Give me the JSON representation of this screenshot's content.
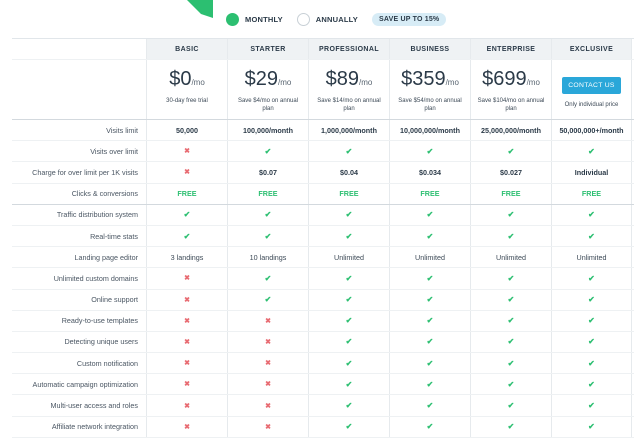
{
  "colors": {
    "accent": "#2cbf71",
    "cross": "#e86b72",
    "button": "#2aa7d9",
    "header_bg": "#eff2f4"
  },
  "billing": {
    "monthly_label": "MONTHLY",
    "annually_label": "ANNUALLY",
    "selected": "MONTHLY",
    "save_badge": "SAVE UP TO 15%"
  },
  "plans": [
    {
      "name": "BASIC",
      "price": "$0",
      "per": "/mo",
      "note": "30-day free trial"
    },
    {
      "name": "STARTER",
      "price": "$29",
      "per": "/mo",
      "note": "Save $4/mo on annual plan"
    },
    {
      "name": "PROFESSIONAL",
      "price": "$89",
      "per": "/mo",
      "note": "Save $14/mo on annual plan"
    },
    {
      "name": "BUSINESS",
      "price": "$359",
      "per": "/mo",
      "note": "Save $54/mo on annual plan"
    },
    {
      "name": "ENTERPRISE",
      "price": "$699",
      "per": "/mo",
      "note": "Save $104/mo on annual plan"
    },
    {
      "name": "EXCLUSIVE",
      "button": "CONTACT US",
      "note": "Only individual price"
    }
  ],
  "rows": [
    {
      "label": "Visits limit",
      "cells": [
        {
          "t": "text",
          "v": "50,000",
          "b": true
        },
        {
          "t": "text",
          "v": "100,000/month",
          "b": true
        },
        {
          "t": "text",
          "v": "1,000,000/month",
          "b": true
        },
        {
          "t": "text",
          "v": "10,000,000/month",
          "b": true
        },
        {
          "t": "text",
          "v": "25,000,000/month",
          "b": true
        },
        {
          "t": "text",
          "v": "50,000,000+/month",
          "b": true
        }
      ]
    },
    {
      "label": "Visits over limit",
      "cells": [
        {
          "t": "cross"
        },
        {
          "t": "check"
        },
        {
          "t": "check"
        },
        {
          "t": "check"
        },
        {
          "t": "check"
        },
        {
          "t": "check"
        }
      ]
    },
    {
      "label": "Charge for over limit per 1K visits",
      "cells": [
        {
          "t": "cross"
        },
        {
          "t": "text",
          "v": "$0.07",
          "b": true
        },
        {
          "t": "text",
          "v": "$0.04",
          "b": true
        },
        {
          "t": "text",
          "v": "$0.034",
          "b": true
        },
        {
          "t": "text",
          "v": "$0.027",
          "b": true
        },
        {
          "t": "text",
          "v": "Individual",
          "b": true
        }
      ]
    },
    {
      "label": "Clicks & conversions",
      "group_end": true,
      "cells": [
        {
          "t": "free",
          "v": "FREE"
        },
        {
          "t": "free",
          "v": "FREE"
        },
        {
          "t": "free",
          "v": "FREE"
        },
        {
          "t": "free",
          "v": "FREE"
        },
        {
          "t": "free",
          "v": "FREE"
        },
        {
          "t": "free",
          "v": "FREE"
        }
      ]
    },
    {
      "label": "Traffic distribution system",
      "cells": [
        {
          "t": "check"
        },
        {
          "t": "check"
        },
        {
          "t": "check"
        },
        {
          "t": "check"
        },
        {
          "t": "check"
        },
        {
          "t": "check"
        }
      ]
    },
    {
      "label": "Real-time stats",
      "cells": [
        {
          "t": "check"
        },
        {
          "t": "check"
        },
        {
          "t": "check"
        },
        {
          "t": "check"
        },
        {
          "t": "check"
        },
        {
          "t": "check"
        }
      ]
    },
    {
      "label": "Landing page editor",
      "cells": [
        {
          "t": "text",
          "v": "3 landings"
        },
        {
          "t": "text",
          "v": "10 landings"
        },
        {
          "t": "text",
          "v": "Unlimited"
        },
        {
          "t": "text",
          "v": "Unlimited"
        },
        {
          "t": "text",
          "v": "Unlimited"
        },
        {
          "t": "text",
          "v": "Unlimited"
        }
      ]
    },
    {
      "label": "Unlimited custom domains",
      "cells": [
        {
          "t": "cross"
        },
        {
          "t": "check"
        },
        {
          "t": "check"
        },
        {
          "t": "check"
        },
        {
          "t": "check"
        },
        {
          "t": "check"
        }
      ]
    },
    {
      "label": "Online support",
      "cells": [
        {
          "t": "cross"
        },
        {
          "t": "check"
        },
        {
          "t": "check"
        },
        {
          "t": "check"
        },
        {
          "t": "check"
        },
        {
          "t": "check"
        }
      ]
    },
    {
      "label": "Ready-to-use templates",
      "cells": [
        {
          "t": "cross"
        },
        {
          "t": "cross"
        },
        {
          "t": "check"
        },
        {
          "t": "check"
        },
        {
          "t": "check"
        },
        {
          "t": "check"
        }
      ]
    },
    {
      "label": "Detecting unique users",
      "cells": [
        {
          "t": "cross"
        },
        {
          "t": "cross"
        },
        {
          "t": "check"
        },
        {
          "t": "check"
        },
        {
          "t": "check"
        },
        {
          "t": "check"
        }
      ]
    },
    {
      "label": "Custom notification",
      "cells": [
        {
          "t": "cross"
        },
        {
          "t": "cross"
        },
        {
          "t": "check"
        },
        {
          "t": "check"
        },
        {
          "t": "check"
        },
        {
          "t": "check"
        }
      ]
    },
    {
      "label": "Automatic campaign optimization",
      "cells": [
        {
          "t": "cross"
        },
        {
          "t": "cross"
        },
        {
          "t": "check"
        },
        {
          "t": "check"
        },
        {
          "t": "check"
        },
        {
          "t": "check"
        }
      ]
    },
    {
      "label": "Multi-user access and roles",
      "cells": [
        {
          "t": "cross"
        },
        {
          "t": "cross"
        },
        {
          "t": "check"
        },
        {
          "t": "check"
        },
        {
          "t": "check"
        },
        {
          "t": "check"
        }
      ]
    },
    {
      "label": "Affiliate network integration",
      "cells": [
        {
          "t": "cross"
        },
        {
          "t": "cross"
        },
        {
          "t": "check"
        },
        {
          "t": "check"
        },
        {
          "t": "check"
        },
        {
          "t": "check"
        }
      ]
    }
  ]
}
